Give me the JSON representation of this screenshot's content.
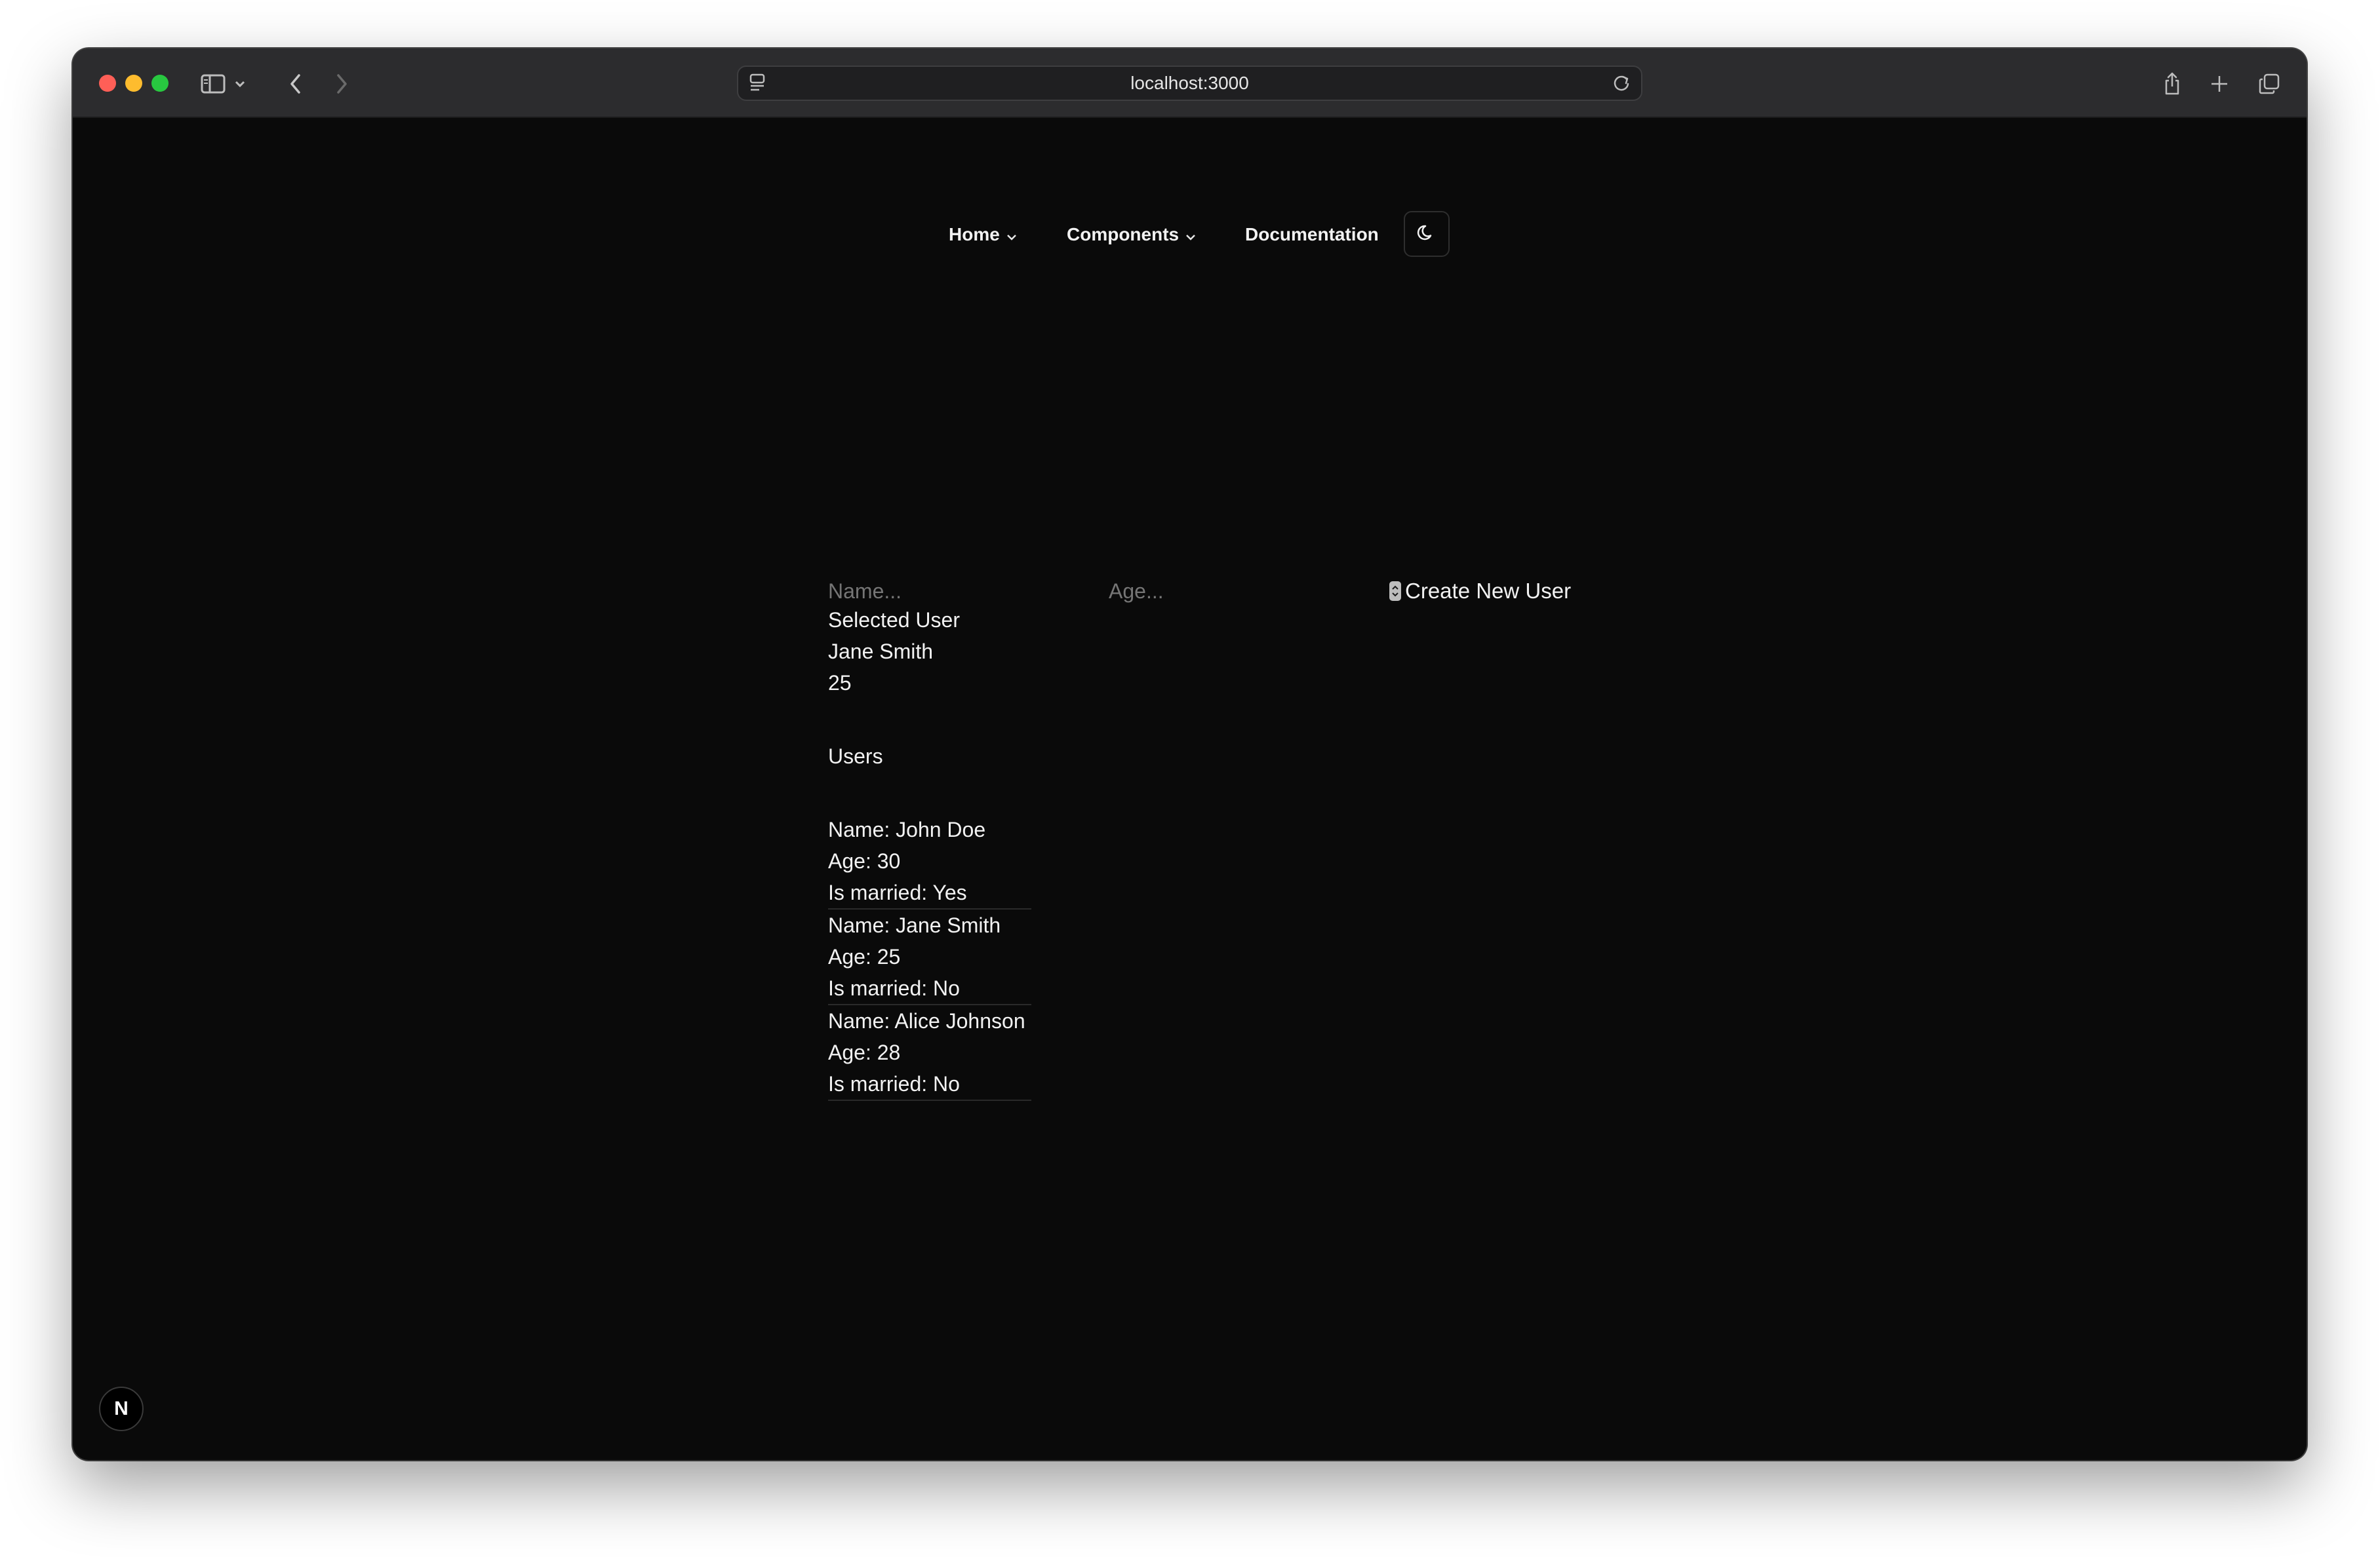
{
  "browser": {
    "url": "localhost:3000"
  },
  "nav": {
    "home_label": "Home",
    "components_label": "Components",
    "documentation_label": "Documentation"
  },
  "form": {
    "name_placeholder": "Name...",
    "age_placeholder": "Age...",
    "create_label": "Create New User"
  },
  "selected": {
    "heading": "Selected User",
    "name": "Jane Smith",
    "age": "25"
  },
  "users": {
    "heading": "Users",
    "list": [
      {
        "name": "Name: John Doe",
        "age": "Age: 30",
        "married": "Is married: Yes"
      },
      {
        "name": "Name: Jane Smith",
        "age": "Age: 25",
        "married": "Is married: No"
      },
      {
        "name": "Name: Alice Johnson",
        "age": "Age: 28",
        "married": "Is married: No"
      }
    ]
  },
  "badge": {
    "letter": "N"
  },
  "colors": {
    "page_bg": "#0a0a0a",
    "titlebar": "#2c2c2e",
    "text": "#f2f2f2",
    "placeholder": "#7d7d7d"
  }
}
